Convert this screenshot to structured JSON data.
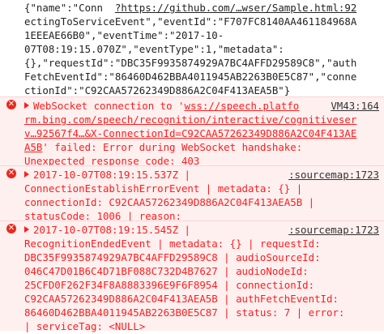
{
  "info_message": {
    "lines": [
      {
        "pre": "{\"name\":\"Conn  ",
        "link": "?https://github.com/…wser/Sample.html:92",
        "post": ""
      },
      {
        "pre": "ectingToServiceEvent\",\"eventId\":\"F707FC8140AA461184968A",
        "link": "",
        "post": ""
      },
      {
        "pre": "1EEEAE66B0\",\"eventTime\":\"2017-10-",
        "link": "",
        "post": ""
      },
      {
        "pre": "07T08:19:15.070Z\",\"eventType\":1,\"metadata\":",
        "link": "",
        "post": ""
      },
      {
        "pre": "{},\"requestId\":\"DBC35F9935874929A7BC4AFFD29589C8\",\"auth",
        "link": "",
        "post": ""
      },
      {
        "pre": "FetchEventId\":\"86460D462BBA4011945AB2263B0E5C87\",\"conne",
        "link": "",
        "post": ""
      },
      {
        "pre": "ctionId\":\"C92CAA57262349D886A2C04F413AEA5B\"}",
        "link": "",
        "post": ""
      }
    ]
  },
  "errors": [
    {
      "lines": [
        {
          "pre": "WebSocket connection to '",
          "link": "wss://speech.platfo",
          "post": "",
          "source": "VM43:164"
        },
        {
          "pre": "",
          "link": "rm.bing.com/speech/recognition/interactive/cognitiveser",
          "post": ""
        },
        {
          "pre": "",
          "link": "v…92567f4…&X-ConnectionId=C92CAA57262349D886A2C04F413AE",
          "post": ""
        },
        {
          "pre": "",
          "link": "A5B",
          "post": "' failed: Error during WebSocket handshake:"
        },
        {
          "pre": "Unexpected response code: 403",
          "link": "",
          "post": ""
        }
      ]
    },
    {
      "lines": [
        {
          "pre": "2017-10-07T08:19:15.537Z |",
          "link": "",
          "post": "",
          "source": ":sourcemap:1723"
        },
        {
          "pre": "ConnectionEstablishErrorEvent | metadata: {} |",
          "link": "",
          "post": ""
        },
        {
          "pre": "connectionId: C92CAA57262349D886A2C04F413AEA5B |",
          "link": "",
          "post": ""
        },
        {
          "pre": "statusCode: 1006 | reason:",
          "link": "",
          "post": ""
        }
      ]
    },
    {
      "lines": [
        {
          "pre": "2017-10-07T08:19:15.545Z |",
          "link": "",
          "post": "",
          "source": ":sourcemap:1723"
        },
        {
          "pre": "RecognitionEndedEvent | metadata: {} | requestId:",
          "link": "",
          "post": ""
        },
        {
          "pre": "DBC35F9935874929A7BC4AFFD29589C8 | audioSourceId:",
          "link": "",
          "post": ""
        },
        {
          "pre": "046C47D01B6C4D71BF088C732D4B7627 | audioNodeId:",
          "link": "",
          "post": ""
        },
        {
          "pre": "25CFD0F262F34F8A8883396E9F6F8954 | connectionId:",
          "link": "",
          "post": ""
        },
        {
          "pre": "C92CAA57262349D886A2C04F413AEA5B | authFetchEventId:",
          "link": "",
          "post": ""
        },
        {
          "pre": "86460D462BBA4011945AB2263B0E5C87 | status: 7 | error:",
          "link": "",
          "post": ""
        },
        {
          "pre": "| serviceTag: <NULL>",
          "link": "",
          "post": ""
        }
      ]
    }
  ]
}
